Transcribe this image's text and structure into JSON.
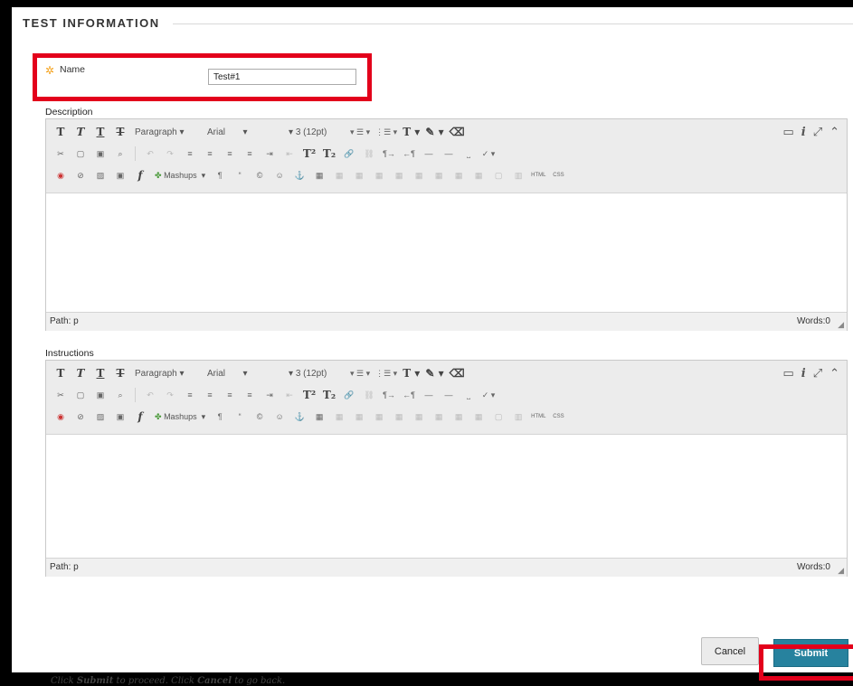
{
  "fieldset": {
    "title": "TEST INFORMATION"
  },
  "name_field": {
    "required_marker": "✲",
    "label": "Name",
    "value": "Test#1"
  },
  "toolbar": {
    "paragraph": "Paragraph",
    "font": "Arial",
    "size": "3 (12pt)",
    "mashups": "Mashups",
    "html": "HTML",
    "css": "CSS"
  },
  "description": {
    "label": "Description",
    "path": "Path: p",
    "words": "Words:0"
  },
  "instructions": {
    "label": "Instructions",
    "path": "Path: p",
    "words": "Words:0"
  },
  "footer": {
    "hint_pre": "Click ",
    "hint_submit": "Submit",
    "hint_mid": " to proceed. Click ",
    "hint_cancel": "Cancel",
    "hint_post": " to go back."
  },
  "buttons": {
    "cancel": "Cancel",
    "submit": "Submit"
  },
  "colors": {
    "highlight": "#e3001b",
    "submit_bg": "#27829e",
    "required": "#f4a11a"
  }
}
